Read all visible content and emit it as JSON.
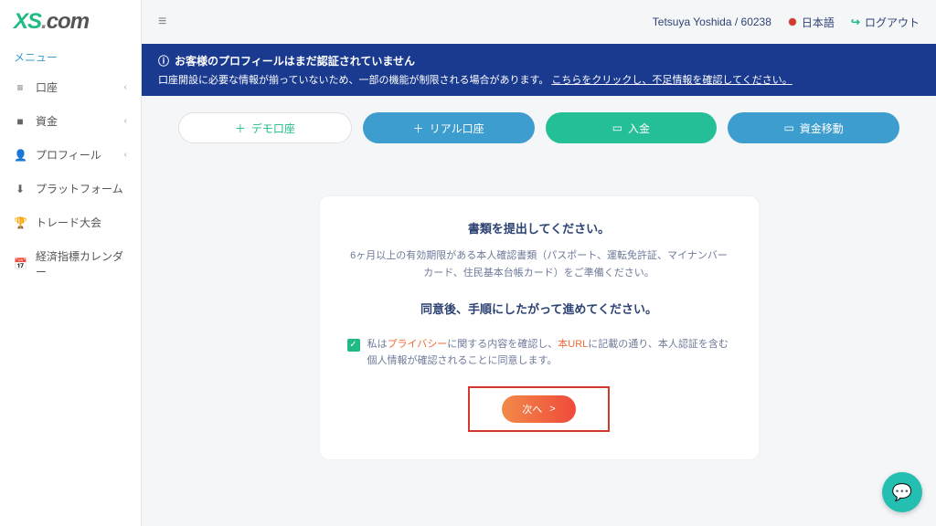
{
  "brand": {
    "xs": "XS",
    "dot": ".",
    "com": "com"
  },
  "sidebar": {
    "title": "メニュー",
    "items": [
      {
        "icon": "≡",
        "label": "口座",
        "expandable": true
      },
      {
        "icon": "■",
        "label": "資金",
        "expandable": true
      },
      {
        "icon": "👤",
        "label": "プロフィール",
        "expandable": true
      },
      {
        "icon": "⬇",
        "label": "プラットフォーム",
        "expandable": false
      },
      {
        "icon": "🏆",
        "label": "トレード大会",
        "expandable": false
      },
      {
        "icon": "📅",
        "label": "経済指標カレンダー",
        "expandable": false
      }
    ]
  },
  "topbar": {
    "user": "Tetsuya Yoshida / 60238",
    "language": "日本語",
    "logout": "ログアウト"
  },
  "alert": {
    "title": "お客様のプロフィールはまだ認証されていません",
    "message": "口座開設に必要な情報が揃っていないため、一部の機能が制限される場合があります。",
    "link": "こちらをクリックし、不足情報を確認してください。"
  },
  "actions": {
    "demo": "デモ口座",
    "real": "リアル口座",
    "deposit": "入金",
    "transfer": "資金移動"
  },
  "card": {
    "title": "書類を提出してください。",
    "desc": "6ヶ月以上の有効期限がある本人確認書類（パスポート、運転免許証、マイナンバーカード、住民基本台帳カード）をご準備ください。",
    "sub": "同意後、手順にしたがって進めてください。",
    "consent_pre": "私は",
    "consent_privacy": "プライバシー",
    "consent_mid": "に関する内容を確認し、",
    "consent_url": "本URL",
    "consent_post": "に記載の通り、本人認証を含む個人情報が確認されることに同意します。",
    "next": "次へ",
    "next_arrow": ">"
  }
}
